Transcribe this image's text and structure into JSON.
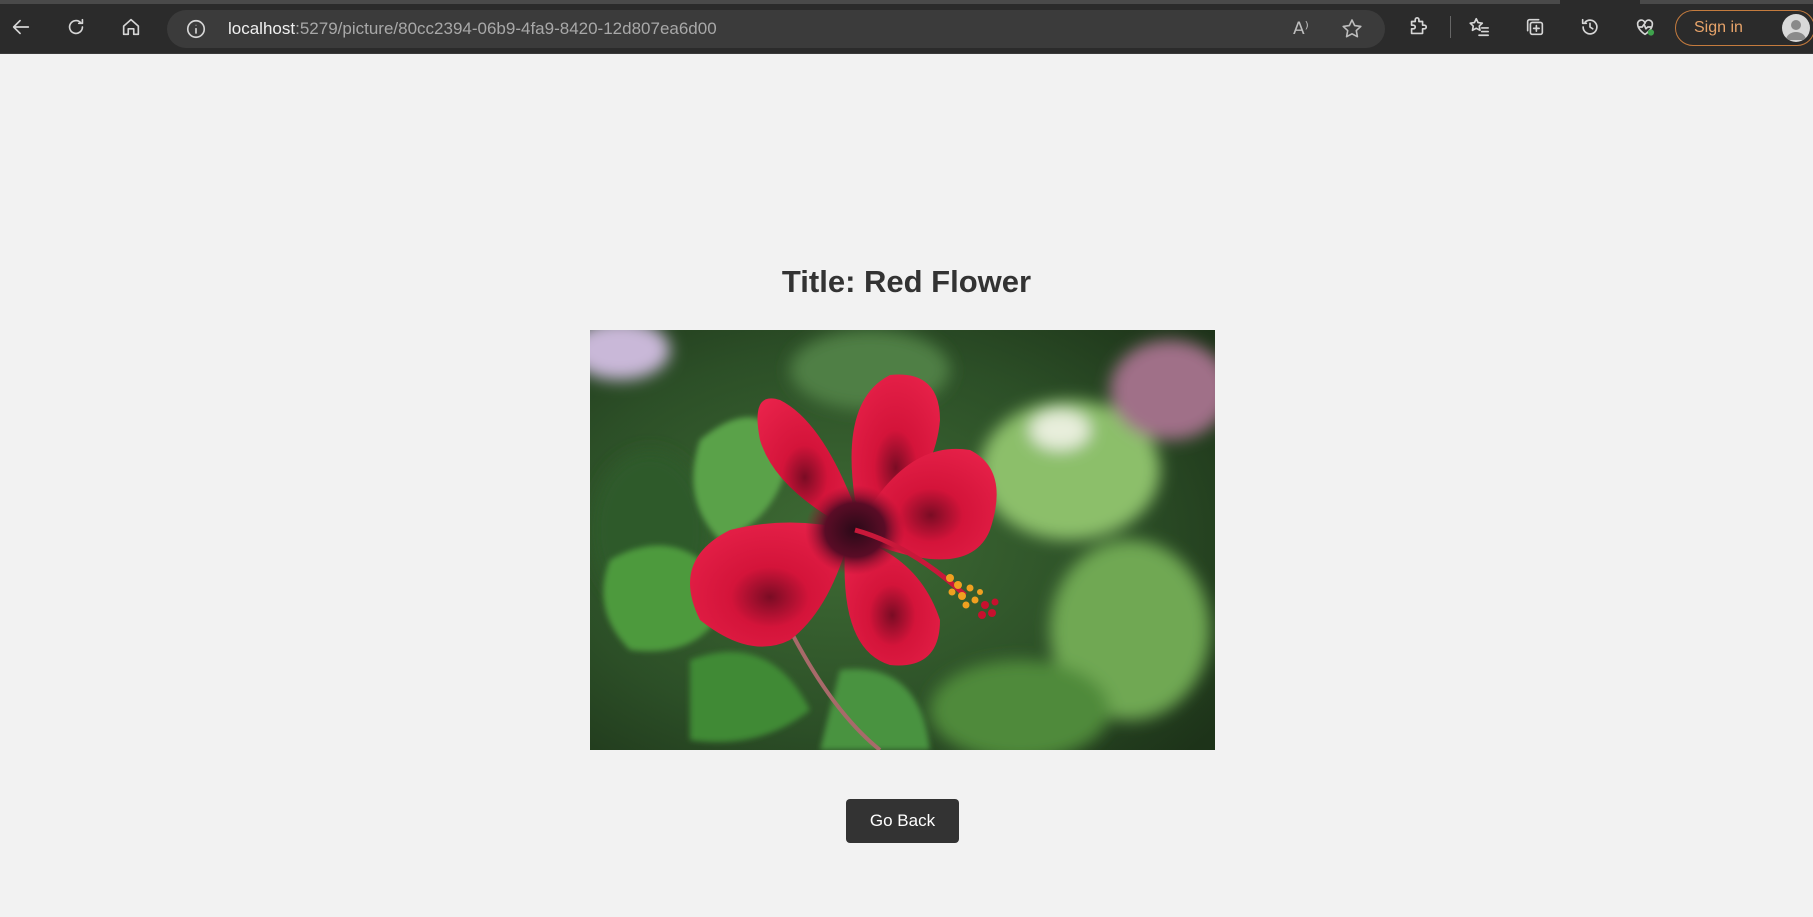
{
  "browser": {
    "url_host": "localhost",
    "url_path": ":5279/picture/80cc2394-06b9-4fa9-8420-12d807ea6d00",
    "signin_label": "Sign in",
    "read_aloud_glyph": "A⁾",
    "more_glyph": "·",
    "accent_color": "#c47b3e"
  },
  "page": {
    "title": "Title: Red Flower",
    "image_alt": "Red Flower",
    "back_button": "Go Back"
  }
}
